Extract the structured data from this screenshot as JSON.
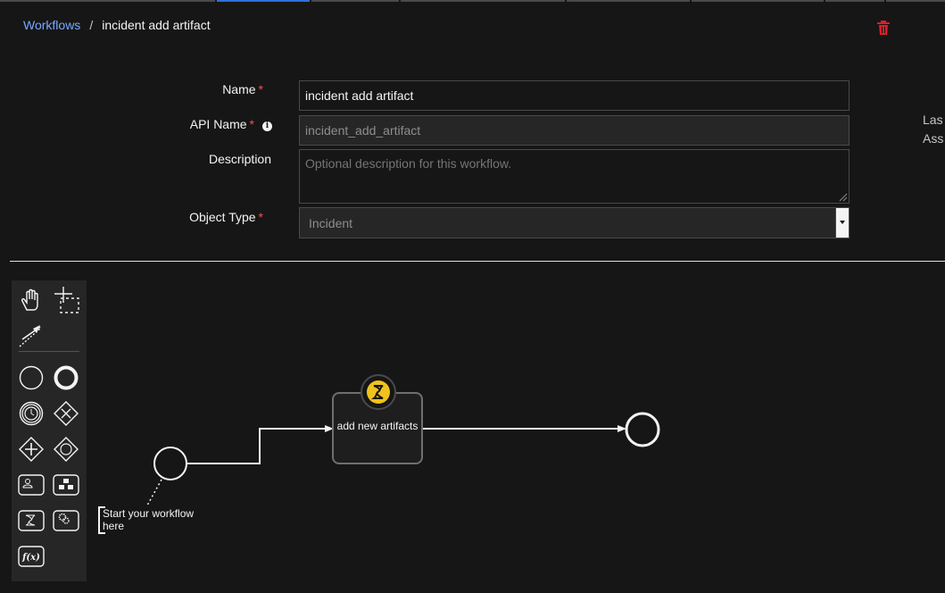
{
  "breadcrumb": {
    "parent": "Workflows",
    "separator": "/",
    "current": "incident add artifact"
  },
  "form": {
    "name_label": "Name",
    "name_value": "incident add artifact",
    "api_name_label": "API Name",
    "api_name_value": "incident_add_artifact",
    "description_label": "Description",
    "description_placeholder": "Optional description for this workflow.",
    "object_type_label": "Object Type",
    "object_type_value": "Incident",
    "required_marker": "*"
  },
  "side_panel": {
    "line1": "Las",
    "line2": "Ass"
  },
  "diagram": {
    "task_label": "add new artifacts",
    "annotation": "Start your workflow here"
  },
  "colors": {
    "link": "#78a9ff",
    "required": "#fa4d56",
    "accent_tab": "#2f6fdf",
    "badge": "#f1c21b",
    "delete": "#da1e28"
  }
}
